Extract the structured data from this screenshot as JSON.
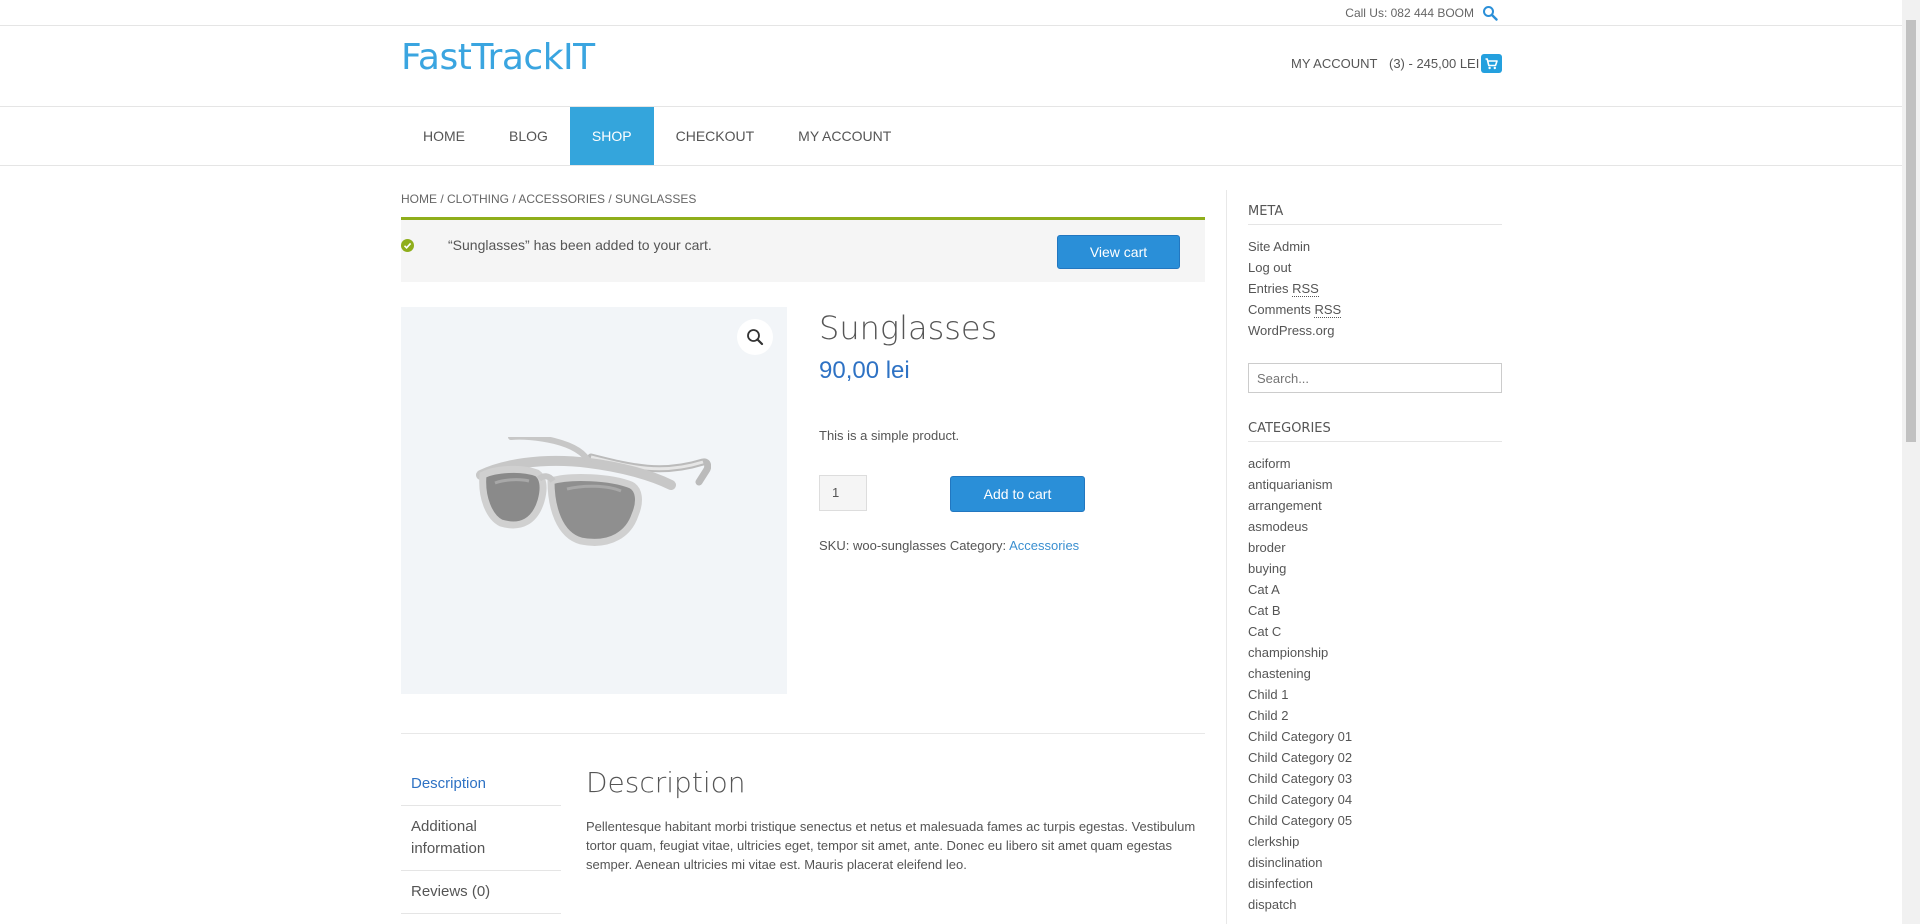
{
  "topbar": {
    "call_text": "Call Us: 082 444 BOOM"
  },
  "header": {
    "logo": "FastTrackIT",
    "account_label": "MY ACCOUNT",
    "cart_text": "(3) - 245,00 LEI"
  },
  "nav": {
    "items": [
      {
        "label": "HOME"
      },
      {
        "label": "BLOG"
      },
      {
        "label": "SHOP"
      },
      {
        "label": "CHECKOUT"
      },
      {
        "label": "MY ACCOUNT"
      }
    ],
    "active": "SHOP"
  },
  "breadcrumb": "HOME / CLOTHING / ACCESSORIES / SUNGLASSES",
  "notice": {
    "message": "“Sunglasses” has been added to your cart.",
    "button": "View cart"
  },
  "product": {
    "title": "Sunglasses",
    "price": "90,00 lei",
    "short_description": "This is a simple product.",
    "quantity": "1",
    "add_to_cart": "Add to cart",
    "sku_label": "SKU:",
    "sku": "woo-sunglasses",
    "category_label": "Category:",
    "category": "Accessories"
  },
  "tabs": {
    "items": [
      {
        "label": "Description"
      },
      {
        "label": "Additional information"
      },
      {
        "label": "Reviews (0)"
      }
    ],
    "active": "Description"
  },
  "description": {
    "title": "Description",
    "text": "Pellentesque habitant morbi tristique senectus et netus et malesuada fames ac turpis egestas. Vestibulum tortor quam, feugiat vitae, ultricies eget, tempor sit amet, ante. Donec eu libero sit amet quam egestas semper. Aenean ultricies mi vitae est. Mauris placerat eleifend leo."
  },
  "sidebar": {
    "meta_title": "META",
    "meta_links": [
      {
        "label": "Site Admin"
      },
      {
        "label": "Log out"
      },
      {
        "label": "Entries",
        "rss": "RSS"
      },
      {
        "label": "Comments",
        "rss": "RSS"
      },
      {
        "label": "WordPress.org"
      }
    ],
    "search_placeholder": "Search...",
    "categories_title": "CATEGORIES",
    "categories": [
      "aciform",
      "antiquarianism",
      "arrangement",
      "asmodeus",
      "broder",
      "buying",
      "Cat A",
      "Cat B",
      "Cat C",
      "championship",
      "chastening",
      "Child 1",
      "Child 2",
      "Child Category 01",
      "Child Category 02",
      "Child Category 03",
      "Child Category 04",
      "Child Category 05",
      "clerkship",
      "disinclination",
      "disinfection",
      "dispatch"
    ]
  },
  "colors": {
    "brand": "#3aa5e0",
    "button": "#2a8fd8",
    "nav_active": "#34a5dc",
    "notice_accent": "#8fae1b",
    "price": "#2e72c4"
  }
}
